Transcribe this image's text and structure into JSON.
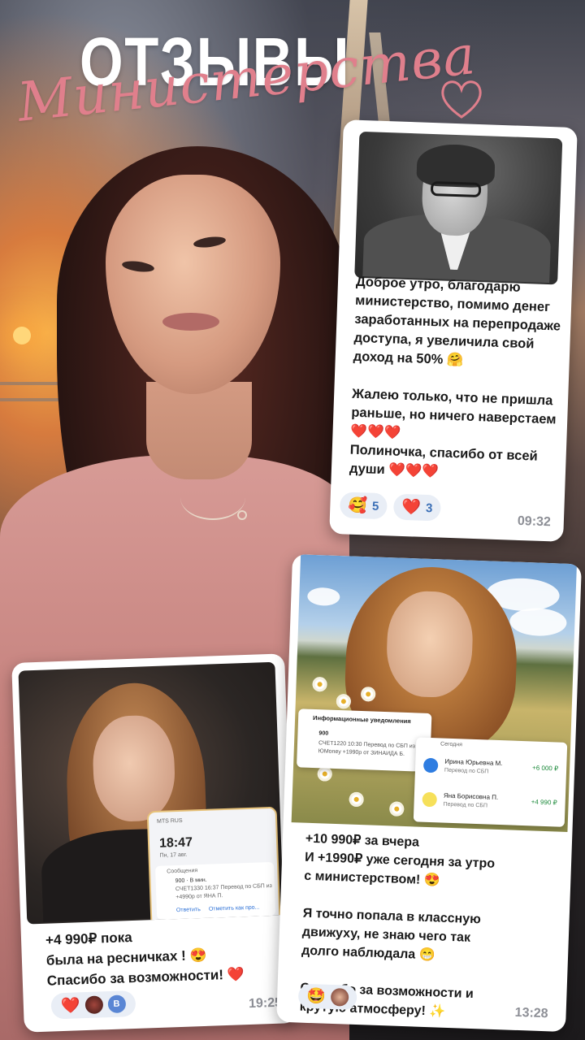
{
  "header": {
    "title": "ОТЗЫВЫ",
    "subtitle": "Министерства",
    "heart_icon": "heart-outline-icon",
    "accent_color": "#e07f8c"
  },
  "card1": {
    "text": "Доброе утро, благодарю министерство, помимо денег заработанных на перепродаже доступа, я увеличила свой доход на 50% 🤗\n\nЖалею только, что не пришла раньше, но ничего наверстаем ❤️❤️❤️\nПолиночка, спасибо от всей души ❤️❤️❤️",
    "reactions": [
      {
        "emoji": "🥰",
        "count": "5"
      },
      {
        "emoji": "❤️",
        "count": "3"
      }
    ],
    "time": "09:32"
  },
  "card2": {
    "text": "+4 990₽ пока\nбыла на ресничках ! 😍\nСпасибо за возможности! ❤️",
    "reactions": [
      {
        "emoji": "❤️"
      },
      {
        "avatar_letter": "В"
      }
    ],
    "time": "19:25",
    "phone": {
      "carrier": "MTS RUS",
      "clock": "18:47",
      "date": "Пн, 17 авг.",
      "app": "Сообщения",
      "sender": "900 · В мин.",
      "msg1": "СЧЕТ1330 16:37 Перевод по СБП из",
      "msg2": "+4990р от ЯНА П.",
      "reply": "Ответить",
      "mark": "Отметить как про..."
    }
  },
  "card3": {
    "text": "+10 990₽ за вчера\nИ +1990₽ уже сегодня за утро\nс министерством! 😍\n\nЯ точно попала в классную\nдвижуху, не знаю чего так\nдолго наблюдала 😁\n\nСпасибо за возможности и\nкрутую атмосферу! ✨",
    "reactions": [
      {
        "emoji": "🤩"
      },
      {
        "avatar": "avatar"
      }
    ],
    "time": "13:28",
    "notice_left": {
      "title": "Информационные уведомления",
      "sender": "900",
      "line1": "СЧЕТ1220 10:30 Перевод по СБП из",
      "line2": "ЮMoney +1990р от ЗИНАИДА Б."
    },
    "notice_right": {
      "header": "Сегодня",
      "rows": [
        {
          "name": "Ирина Юрьевна М.",
          "desc": "Перевод по СБП",
          "amount": "+6 000 ₽"
        },
        {
          "name": "Яна Борисовна П.",
          "desc": "Перевод по СБП",
          "amount": "+4 990 ₽"
        }
      ]
    }
  }
}
